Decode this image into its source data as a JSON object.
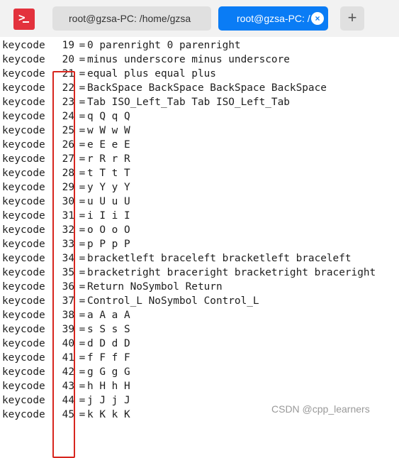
{
  "tabs": [
    {
      "label": "root@gzsa-PC: /home/gzsa",
      "active": false
    },
    {
      "label": "root@gzsa-PC: /",
      "active": true
    }
  ],
  "new_tab_label": "+",
  "close_label": "×",
  "colors": {
    "accent": "#0a7cf5",
    "app_icon": "#e3323d",
    "highlight": "#d7261e"
  },
  "terminal": {
    "lines": [
      {
        "prefix": "keycode",
        "code": "19",
        "value": "0 parenright 0 parenright"
      },
      {
        "prefix": "keycode",
        "code": "20",
        "value": "minus underscore minus underscore"
      },
      {
        "prefix": "keycode",
        "code": "21",
        "value": "equal plus equal plus"
      },
      {
        "prefix": "keycode",
        "code": "22",
        "value": "BackSpace BackSpace BackSpace BackSpace"
      },
      {
        "prefix": "keycode",
        "code": "23",
        "value": "Tab ISO_Left_Tab Tab ISO_Left_Tab"
      },
      {
        "prefix": "keycode",
        "code": "24",
        "value": "q Q q Q"
      },
      {
        "prefix": "keycode",
        "code": "25",
        "value": "w W w W"
      },
      {
        "prefix": "keycode",
        "code": "26",
        "value": "e E e E"
      },
      {
        "prefix": "keycode",
        "code": "27",
        "value": "r R r R"
      },
      {
        "prefix": "keycode",
        "code": "28",
        "value": "t T t T"
      },
      {
        "prefix": "keycode",
        "code": "29",
        "value": "y Y y Y"
      },
      {
        "prefix": "keycode",
        "code": "30",
        "value": "u U u U"
      },
      {
        "prefix": "keycode",
        "code": "31",
        "value": "i I i I"
      },
      {
        "prefix": "keycode",
        "code": "32",
        "value": "o O o O"
      },
      {
        "prefix": "keycode",
        "code": "33",
        "value": "p P p P"
      },
      {
        "prefix": "keycode",
        "code": "34",
        "value": "bracketleft braceleft bracketleft braceleft"
      },
      {
        "prefix": "keycode",
        "code": "35",
        "value": "bracketright braceright bracketright braceright"
      },
      {
        "prefix": "keycode",
        "code": "36",
        "value": "Return NoSymbol Return"
      },
      {
        "prefix": "keycode",
        "code": "37",
        "value": "Control_L NoSymbol Control_L"
      },
      {
        "prefix": "keycode",
        "code": "38",
        "value": "a A a A"
      },
      {
        "prefix": "keycode",
        "code": "39",
        "value": "s S s S"
      },
      {
        "prefix": "keycode",
        "code": "40",
        "value": "d D d D"
      },
      {
        "prefix": "keycode",
        "code": "41",
        "value": "f F f F"
      },
      {
        "prefix": "keycode",
        "code": "42",
        "value": "g G g G"
      },
      {
        "prefix": "keycode",
        "code": "43",
        "value": "h H h H"
      },
      {
        "prefix": "keycode",
        "code": "44",
        "value": "j J j J"
      },
      {
        "prefix": "keycode",
        "code": "45",
        "value": "k K k K"
      }
    ]
  },
  "watermark": "CSDN @cpp_learners"
}
